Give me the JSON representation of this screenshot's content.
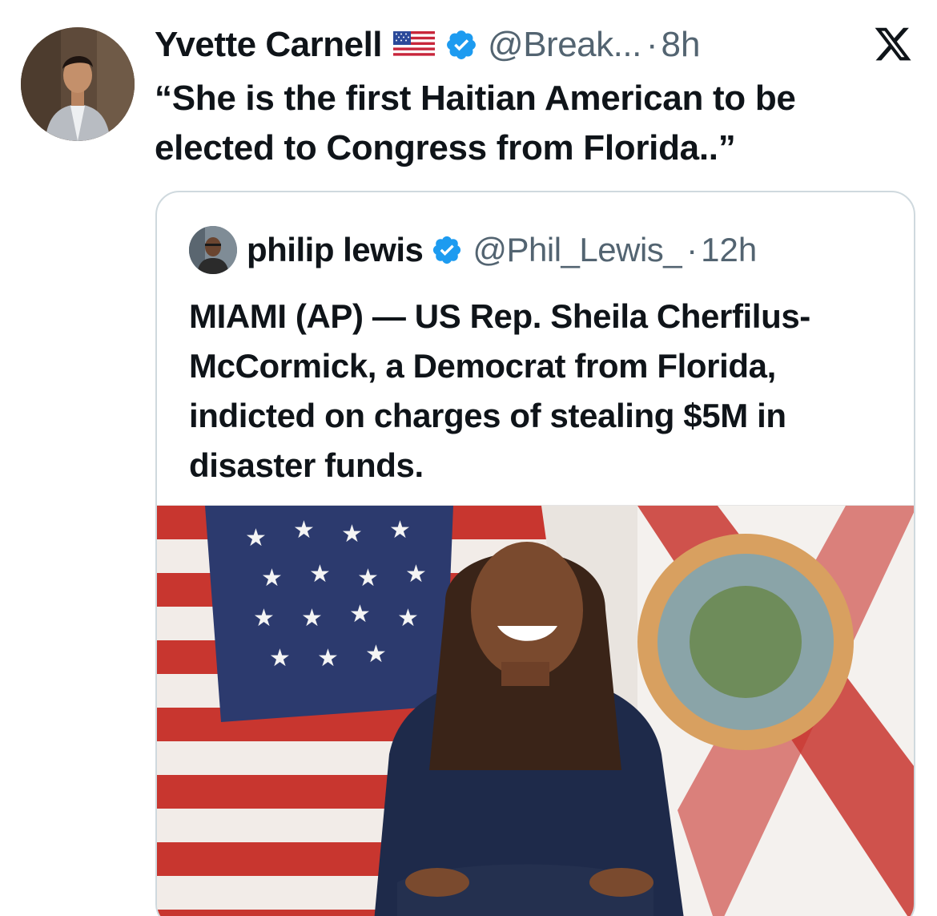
{
  "tweet": {
    "author_name": "Yvette Carnell",
    "author_flag": "us-flag-emoji",
    "handle": "@Break...",
    "dot": "·",
    "time": "8h",
    "text": "“She is the first Haitian American to be elected to Congress from Florida..”"
  },
  "quoted_tweet": {
    "author_name": "philip lewis",
    "handle": "@Phil_Lewis_",
    "dot": "·",
    "time": "12h",
    "text": "MIAMI (AP) — US Rep. Sheila Cherfilus-McCormick, a Democrat from Florida, indicted on charges of stealing $5M in disaster funds."
  },
  "colors": {
    "verified_blue": "#1d9bf0",
    "text_primary": "#0f1419",
    "text_secondary": "#536471",
    "border": "#cfd9de"
  },
  "icons": {
    "verified": "verified-badge-icon",
    "platform": "x-logo-icon"
  }
}
